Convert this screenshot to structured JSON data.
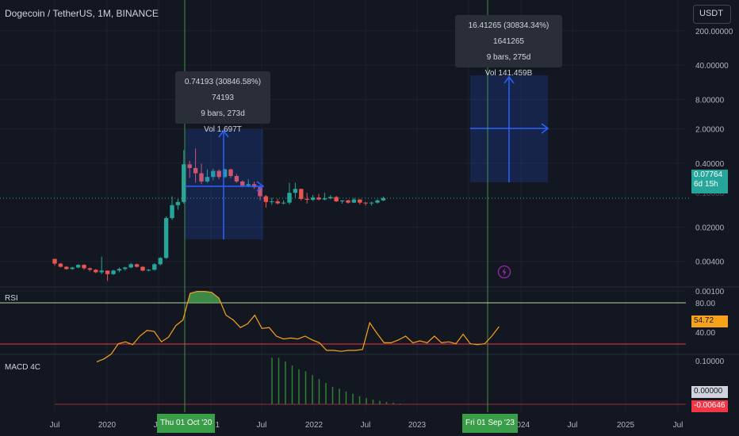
{
  "header": {
    "symbol_title": "Dogecoin / TetherUS, 1M, BINANCE",
    "currency": "USDT"
  },
  "price_axis": {
    "ticks": [
      "200.00000",
      "40.00000",
      "8.00000",
      "2.00000",
      "0.40000",
      "0.02000",
      "0.00400",
      "0.00100"
    ],
    "partial_tick": "0.10000",
    "last_price": "0.07764",
    "countdown": "6d 15h"
  },
  "time_axis": {
    "ticks": [
      "Jul",
      "2020",
      "Jul",
      "2021",
      "Jul",
      "2022",
      "Jul",
      "2023",
      "Jul",
      "2024",
      "Jul",
      "2025",
      "Jul"
    ],
    "crosshair_labels": [
      "Thu 01 Oct '20",
      "Fri 01 Sep '23"
    ]
  },
  "measure_tooltips": [
    {
      "change": "0.74193 (30846.58%) 74193",
      "bars": "9 bars, 273d",
      "volume": "Vol 1.697T"
    },
    {
      "change": "16.41265 (30834.34%) 1641265",
      "bars": "9 bars, 275d",
      "volume": "Vol 141.459B"
    }
  ],
  "rsi": {
    "label": "RSI",
    "levels": [
      "80.00",
      "40.00"
    ],
    "current": "54.72",
    "series": [
      18,
      21,
      26,
      37,
      39,
      36,
      45,
      51,
      50,
      39,
      44,
      56,
      62,
      90,
      92,
      92,
      91,
      85,
      67,
      62,
      54,
      58,
      67,
      53,
      54,
      45,
      42,
      43,
      42,
      45,
      41,
      38,
      30,
      30,
      29,
      30,
      30,
      31,
      59,
      48,
      38,
      38,
      41,
      45,
      38,
      40,
      38,
      45,
      38,
      39,
      37,
      47,
      37,
      36,
      37,
      45,
      55
    ]
  },
  "macd": {
    "label": "MACD 4C",
    "scale_tick": "0.10000",
    "value_label": "0.00000",
    "signal_label": "-0.00646",
    "bars": [
      0.12,
      0.12,
      0.11,
      0.1,
      0.09,
      0.085,
      0.075,
      0.065,
      0.055,
      0.045,
      0.04,
      0.033,
      0.027,
      0.021,
      0.016,
      0.012,
      0.009,
      0.006,
      0.004,
      0.002
    ]
  },
  "colors": {
    "up": "#26a69a",
    "down": "#ef5350",
    "rsi_line": "#f7a21b",
    "measure": "#2962ff",
    "crosshair": "#4caf50",
    "level_high": "#b5d68f",
    "level_low": "#f23645"
  },
  "chart_data": {
    "type": "candlestick",
    "y_scale": "log",
    "candles": [
      {
        "o": 0.0045,
        "c": 0.0036,
        "h": 0.0045,
        "l": 0.0033
      },
      {
        "o": 0.0036,
        "c": 0.0031,
        "h": 0.0037,
        "l": 0.003
      },
      {
        "o": 0.0031,
        "c": 0.0028,
        "h": 0.0032,
        "l": 0.0027
      },
      {
        "o": 0.0028,
        "c": 0.003,
        "h": 0.0031,
        "l": 0.0027
      },
      {
        "o": 0.003,
        "c": 0.0034,
        "h": 0.0035,
        "l": 0.0029
      },
      {
        "o": 0.0034,
        "c": 0.0029,
        "h": 0.0035,
        "l": 0.0027
      },
      {
        "o": 0.0029,
        "c": 0.0027,
        "h": 0.003,
        "l": 0.0025
      },
      {
        "o": 0.0027,
        "c": 0.0024,
        "h": 0.0028,
        "l": 0.0023
      },
      {
        "o": 0.0024,
        "c": 0.0026,
        "h": 0.005,
        "l": 0.0022
      },
      {
        "o": 0.0026,
        "c": 0.0022,
        "h": 0.0026,
        "l": 0.0016
      },
      {
        "o": 0.0022,
        "c": 0.0026,
        "h": 0.0027,
        "l": 0.0021
      },
      {
        "o": 0.0026,
        "c": 0.0028,
        "h": 0.003,
        "l": 0.0024
      },
      {
        "o": 0.0028,
        "c": 0.003,
        "h": 0.0031,
        "l": 0.0026
      },
      {
        "o": 0.003,
        "c": 0.0035,
        "h": 0.0037,
        "l": 0.0029
      },
      {
        "o": 0.0035,
        "c": 0.0031,
        "h": 0.0036,
        "l": 0.003
      },
      {
        "o": 0.0031,
        "c": 0.0026,
        "h": 0.0032,
        "l": 0.0025
      },
      {
        "o": 0.0026,
        "c": 0.0027,
        "h": 0.0028,
        "l": 0.0025
      },
      {
        "o": 0.0027,
        "c": 0.0035,
        "h": 0.0037,
        "l": 0.0026
      },
      {
        "o": 0.0035,
        "c": 0.0047,
        "h": 0.0049,
        "l": 0.0033
      },
      {
        "o": 0.0047,
        "c": 0.0305,
        "h": 0.033,
        "l": 0.0045
      },
      {
        "o": 0.0305,
        "c": 0.056,
        "h": 0.085,
        "l": 0.028
      },
      {
        "o": 0.056,
        "c": 0.065,
        "h": 0.075,
        "l": 0.045
      },
      {
        "o": 0.065,
        "c": 0.38,
        "h": 0.74,
        "l": 0.06
      },
      {
        "o": 0.38,
        "c": 0.32,
        "h": 0.45,
        "l": 0.2
      },
      {
        "o": 0.32,
        "c": 0.25,
        "h": 0.8,
        "l": 0.16
      },
      {
        "o": 0.25,
        "c": 0.17,
        "h": 0.39,
        "l": 0.15
      },
      {
        "o": 0.17,
        "c": 0.21,
        "h": 0.3,
        "l": 0.16
      },
      {
        "o": 0.21,
        "c": 0.28,
        "h": 0.31,
        "l": 0.18
      },
      {
        "o": 0.28,
        "c": 0.21,
        "h": 0.3,
        "l": 0.19
      },
      {
        "o": 0.21,
        "c": 0.3,
        "h": 0.31,
        "l": 0.2
      },
      {
        "o": 0.3,
        "c": 0.22,
        "h": 0.31,
        "l": 0.2
      },
      {
        "o": 0.22,
        "c": 0.17,
        "h": 0.24,
        "l": 0.16
      },
      {
        "o": 0.17,
        "c": 0.14,
        "h": 0.18,
        "l": 0.13
      },
      {
        "o": 0.14,
        "c": 0.15,
        "h": 0.19,
        "l": 0.13
      },
      {
        "o": 0.15,
        "c": 0.13,
        "h": 0.17,
        "l": 0.12
      },
      {
        "o": 0.13,
        "c": 0.085,
        "h": 0.14,
        "l": 0.07
      },
      {
        "o": 0.085,
        "c": 0.065,
        "h": 0.09,
        "l": 0.05
      },
      {
        "o": 0.065,
        "c": 0.067,
        "h": 0.08,
        "l": 0.057
      },
      {
        "o": 0.067,
        "c": 0.061,
        "h": 0.075,
        "l": 0.058
      },
      {
        "o": 0.061,
        "c": 0.063,
        "h": 0.07,
        "l": 0.058
      },
      {
        "o": 0.063,
        "c": 0.1,
        "h": 0.16,
        "l": 0.058
      },
      {
        "o": 0.1,
        "c": 0.12,
        "h": 0.16,
        "l": 0.08
      },
      {
        "o": 0.12,
        "c": 0.075,
        "h": 0.12,
        "l": 0.07
      },
      {
        "o": 0.075,
        "c": 0.072,
        "h": 0.1,
        "l": 0.06
      },
      {
        "o": 0.072,
        "c": 0.08,
        "h": 0.09,
        "l": 0.068
      },
      {
        "o": 0.08,
        "c": 0.073,
        "h": 0.095,
        "l": 0.07
      },
      {
        "o": 0.073,
        "c": 0.077,
        "h": 0.1,
        "l": 0.07
      },
      {
        "o": 0.077,
        "c": 0.082,
        "h": 0.09,
        "l": 0.074
      },
      {
        "o": 0.082,
        "c": 0.067,
        "h": 0.086,
        "l": 0.065
      },
      {
        "o": 0.067,
        "c": 0.07,
        "h": 0.07,
        "l": 0.06
      },
      {
        "o": 0.07,
        "c": 0.063,
        "h": 0.072,
        "l": 0.06
      },
      {
        "o": 0.063,
        "c": 0.073,
        "h": 0.079,
        "l": 0.062
      },
      {
        "o": 0.073,
        "c": 0.063,
        "h": 0.074,
        "l": 0.058
      },
      {
        "o": 0.063,
        "c": 0.061,
        "h": 0.065,
        "l": 0.055
      },
      {
        "o": 0.061,
        "c": 0.063,
        "h": 0.066,
        "l": 0.055
      },
      {
        "o": 0.063,
        "c": 0.07,
        "h": 0.074,
        "l": 0.06
      },
      {
        "o": 0.07,
        "c": 0.078,
        "h": 0.084,
        "l": 0.068
      }
    ]
  }
}
